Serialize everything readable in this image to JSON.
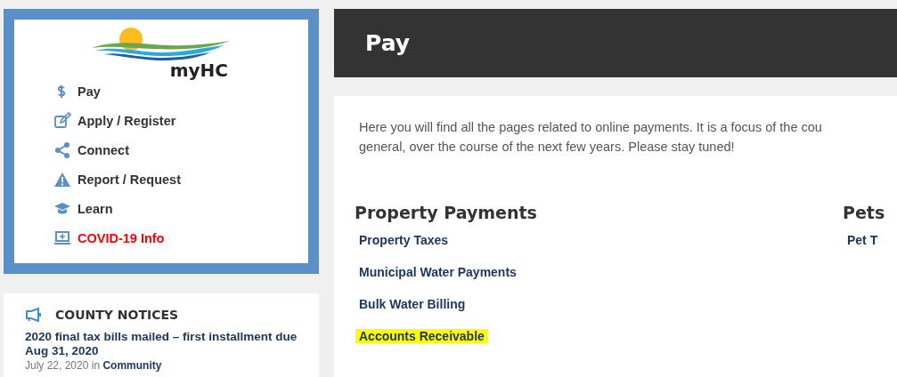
{
  "logo": {
    "text": "myHC"
  },
  "nav": [
    {
      "label": "Pay",
      "kind": "dollar",
      "alert": false
    },
    {
      "label": "Apply / Register",
      "kind": "edit",
      "alert": false
    },
    {
      "label": "Connect",
      "kind": "share",
      "alert": false
    },
    {
      "label": "Report / Request",
      "kind": "warning",
      "alert": false
    },
    {
      "label": "Learn",
      "kind": "cap",
      "alert": false
    },
    {
      "label": "COVID-19 Info",
      "kind": "laptop",
      "alert": true
    }
  ],
  "notices": {
    "title": "COUNTY NOTICES",
    "items": [
      {
        "headline": "2020 final tax bills mailed – first installment due Aug 31, 2020",
        "date": "July 22, 2020 in",
        "category": "Community"
      }
    ]
  },
  "page": {
    "title": "Pay",
    "intro": [
      "Here you will find all the pages related to online payments. It is a focus of the cou",
      "general, over the course of the next few years. Please stay tuned!"
    ],
    "sections": [
      {
        "title": "Property Payments",
        "links": [
          {
            "label": "Property Taxes",
            "highlighted": false
          },
          {
            "label": "Municipal Water Payments",
            "highlighted": false
          },
          {
            "label": "Bulk Water Billing",
            "highlighted": false
          },
          {
            "label": "Accounts Receivable",
            "highlighted": true
          }
        ]
      },
      {
        "title": "Pets",
        "links": [
          {
            "label": "Pet T",
            "highlighted": false
          }
        ]
      }
    ]
  }
}
